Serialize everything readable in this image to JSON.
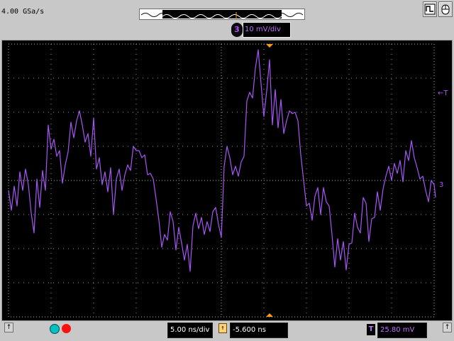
{
  "header": {
    "sample_rate": "4.00 GSa/s"
  },
  "channel": {
    "number": "3",
    "scale": "10 mV/div"
  },
  "markers": {
    "trigger_level_label": "←T",
    "channel_ground_label": "3"
  },
  "footer": {
    "timebase": "5.00 ns/div",
    "delay": "-5.600 ns",
    "trigger_badge": "T",
    "trigger_level": "25.80 mV"
  },
  "colors": {
    "trace": "#a855f7",
    "grid": "#b0b0b0",
    "overview_wave": "#101010",
    "trigger_marker": "#ff9a1f"
  },
  "icons": [
    "scroll-up-icon",
    "run-stop-icon",
    "acquire-icon",
    "channel-color-icon",
    "record-icon",
    "delay-arrow-icon",
    "dropdown-arrow-icon"
  ]
}
